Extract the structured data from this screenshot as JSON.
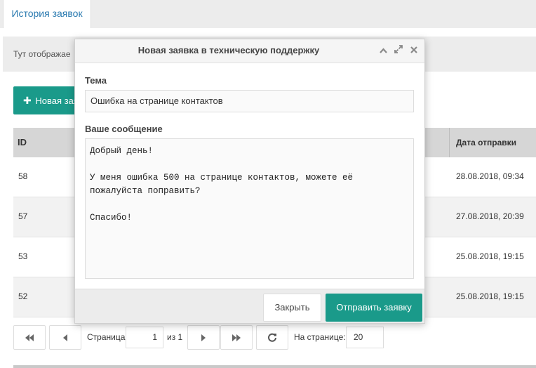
{
  "tabs": [
    {
      "label": "История заявок"
    }
  ],
  "info_bar": {
    "text": "Тут отображае"
  },
  "new_button": {
    "label": "Новая зая"
  },
  "table": {
    "headers": {
      "id": "ID",
      "date": "Дата отправки"
    },
    "rows": [
      {
        "id": "58",
        "date": "28.08.2018, 09:34"
      },
      {
        "id": "57",
        "date": "27.08.2018, 20:39"
      },
      {
        "id": "53",
        "date": "25.08.2018, 19:15"
      },
      {
        "id": "52",
        "date": "25.08.2018, 19:15"
      }
    ]
  },
  "pager": {
    "page_label": "Страница",
    "page_value": "1",
    "of_label": "из 1",
    "per_page_label": "На странице:",
    "per_page_value": "20"
  },
  "modal": {
    "title": "Новая заявка в техническую поддержку",
    "subject_label": "Тема",
    "subject_value": "Ошибка на странице контактов",
    "message_label": "Ваше сообщение",
    "message_value": "Добрый день!\n\nУ меня ошибка 500 на странице контактов, можете её пожалуйста поправить?\n\nСпасибо!",
    "close_label": "Закрыть",
    "send_label": "Отправить заявку"
  },
  "colors": {
    "accent": "#1a9a8a",
    "tab_text": "#2a7ab0"
  }
}
